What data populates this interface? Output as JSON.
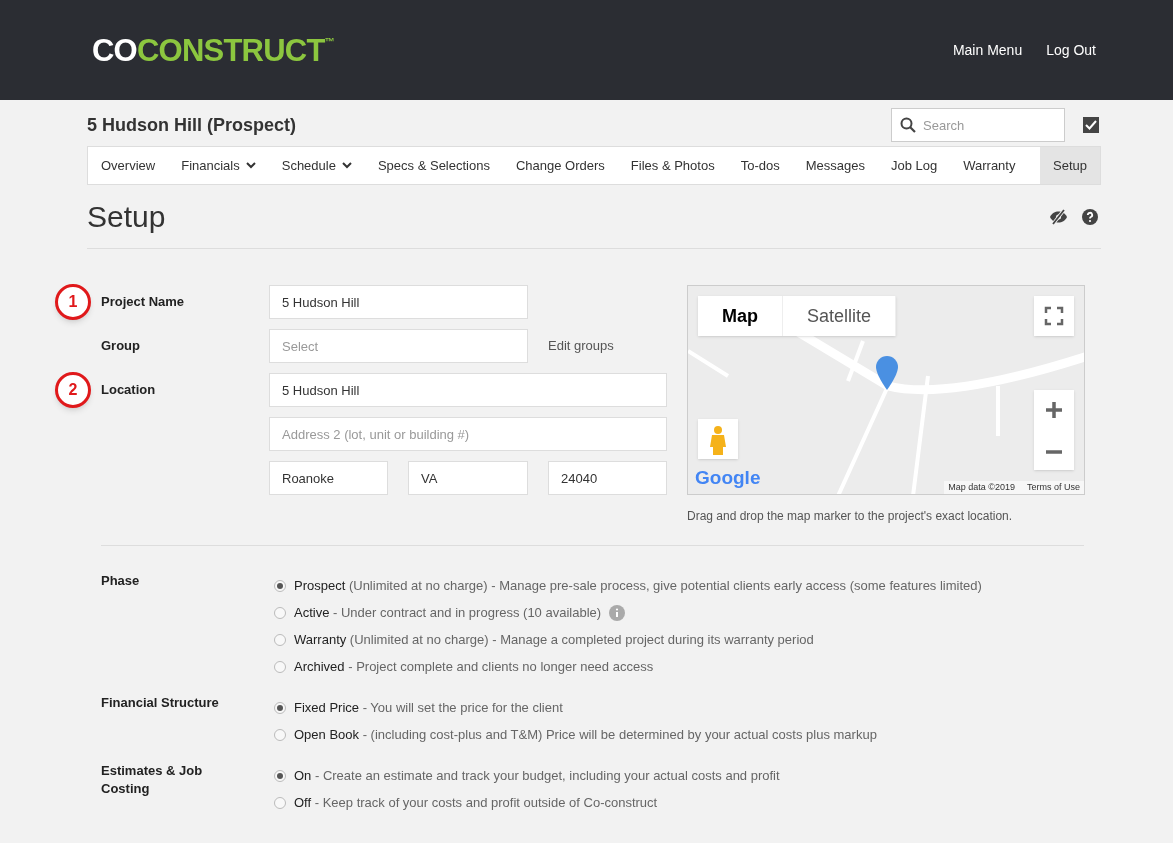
{
  "header": {
    "logo": {
      "part_1": "CO",
      "part_2": "CONSTRUCT",
      "mark": "™"
    },
    "links": [
      "Main Menu",
      "Log Out"
    ]
  },
  "project": {
    "title": "5 Hudson Hill (Prospect)",
    "search": {
      "placeholder": "Search"
    },
    "checkbox": {
      "checked": true
    }
  },
  "tabs": [
    {
      "label": "Overview",
      "dropdown": false,
      "selected": false
    },
    {
      "label": "Financials",
      "dropdown": true,
      "selected": false
    },
    {
      "label": "Schedule",
      "dropdown": true,
      "selected": false
    },
    {
      "label": "Specs & Selections",
      "dropdown": false,
      "selected": false
    },
    {
      "label": "Change Orders",
      "dropdown": false,
      "selected": false
    },
    {
      "label": "Files & Photos",
      "dropdown": false,
      "selected": false
    },
    {
      "label": "To-dos",
      "dropdown": false,
      "selected": false
    },
    {
      "label": "Messages",
      "dropdown": false,
      "selected": false
    },
    {
      "label": "Job Log",
      "dropdown": false,
      "selected": false
    },
    {
      "label": "Warranty",
      "dropdown": false,
      "selected": false
    },
    {
      "label": "Setup",
      "dropdown": false,
      "selected": true
    }
  ],
  "page_title": "Setup",
  "form": {
    "project_name": {
      "badge": "1",
      "label": "Project Name",
      "value": "5 Hudson Hill"
    },
    "group": {
      "label": "Group",
      "placeholder": "Select",
      "link": "Edit groups"
    },
    "location": {
      "badge": "2",
      "label": "Location",
      "address_1": "5 Hudson Hill",
      "address_2_placeholder": "Address 2 (lot, unit or building #)",
      "city": "Roanoke",
      "state": "VA",
      "zip": "24040"
    }
  },
  "map": {
    "types": [
      {
        "label": "Map",
        "selected": true
      },
      {
        "label": "Satellite",
        "selected": false
      }
    ],
    "logo": "Google",
    "attribution": "Map data ©2019",
    "terms": "Terms of Use",
    "hint": "Drag and drop the map marker to the project's exact location."
  },
  "settings": [
    {
      "label": "Phase",
      "options": [
        {
          "name": "Prospect",
          "description": "(Unlimited at no charge) - Manage pre-sale process, give potential clients early access (some features limited)",
          "selected": true,
          "info": false
        },
        {
          "name": "Active",
          "description": "- Under contract and in progress (10 available)",
          "selected": false,
          "info": true
        },
        {
          "name": "Warranty",
          "description": "(Unlimited at no charge) - Manage a completed project during its warranty period",
          "selected": false,
          "info": false
        },
        {
          "name": "Archived",
          "description": "- Project complete and clients no longer need access",
          "selected": false,
          "info": false
        }
      ]
    },
    {
      "label": "Financial Structure",
      "options": [
        {
          "name": "Fixed Price",
          "description": "- You will set the price for the client",
          "selected": true,
          "info": false
        },
        {
          "name": "Open Book",
          "description": "- (including cost-plus and T&M) Price will be determined by your actual costs plus markup",
          "selected": false,
          "info": false
        }
      ]
    },
    {
      "label": "Estimates & Job Costing",
      "options": [
        {
          "name": "On",
          "description": "- Create an estimate and track your budget, including your actual costs and profit",
          "selected": true,
          "info": false
        },
        {
          "name": "Off",
          "description": "- Keep track of your costs and profit outside of Co-construct",
          "selected": false,
          "info": false
        }
      ]
    }
  ]
}
